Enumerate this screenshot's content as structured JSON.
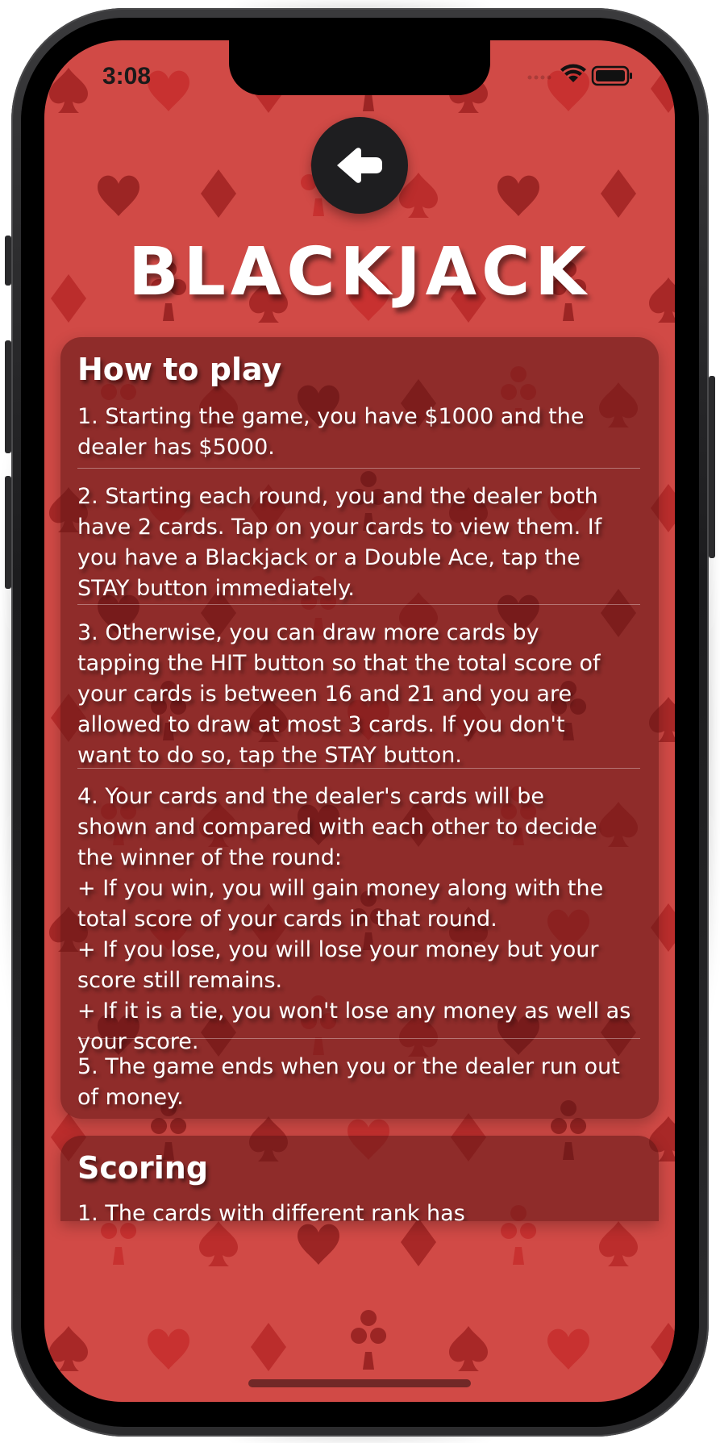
{
  "status_bar": {
    "time": "3:08"
  },
  "header": {
    "title": "BLACKJACK",
    "back_icon": "arrow-left-icon"
  },
  "how_to_play": {
    "heading": "How to play",
    "rules": [
      "1. Starting the game, you have $1000 and the\ndealer has $5000.",
      "2. Starting each round, you and the dealer both\nhave 2 cards. Tap on your cards to view them. If\nyou have a Blackjack or a Double Ace, tap the\nSTAY button immediately.",
      "3. Otherwise, you can draw more cards by\ntapping the HIT button so that the total score of\nyour cards is between 16 and 21 and you are\nallowed to draw at most 3 cards. If you don't\nwant to do so, tap the STAY button.",
      "4. Your cards and the dealer's cards will be\nshown and compared with each other to decide\nthe winner of the round:\n+ If you win, you will gain money along with the\ntotal score of your cards in that round.\n+ If you lose, you will lose your money but your\nscore still remains.\n+ If it is a tie, you won't lose any money as well as\nyour score.",
      "5. The game ends when you or the dealer run out\nof money."
    ]
  },
  "scoring": {
    "heading": "Scoring",
    "first_line": "1. The cards with different rank has"
  },
  "colors": {
    "background": "#d14a46",
    "card": "#5a1414",
    "button": "#1e1e20"
  }
}
